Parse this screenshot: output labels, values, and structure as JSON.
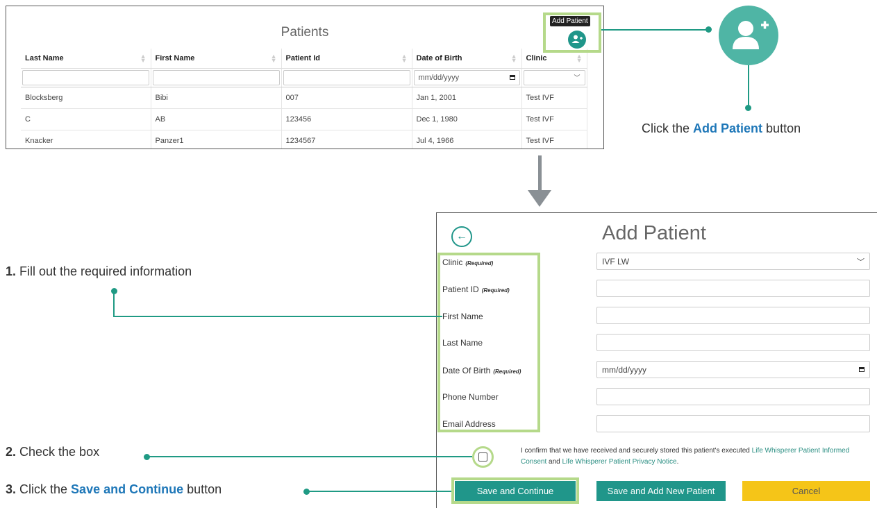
{
  "patients_panel": {
    "title": "Patients",
    "columns": [
      "Last Name",
      "First Name",
      "Patient Id",
      "Date of Birth",
      "Clinic"
    ],
    "date_filter_placeholder": "mm/dd/yyyy",
    "rows": [
      [
        "Blocksberg",
        "Bibi",
        "007",
        "Jan 1, 2001",
        "Test IVF"
      ],
      [
        "C",
        "AB",
        "123456",
        "Dec 1, 1980",
        "Test IVF"
      ],
      [
        "Knacker",
        "Panzer1",
        "1234567",
        "Jul 4, 1966",
        "Test IVF"
      ]
    ],
    "add_tooltip": "Add Patient"
  },
  "callouts": {
    "add_patient_pre": "Click the ",
    "add_patient_hl": "Add Patient",
    "add_patient_post": " button",
    "step1_num": "1.",
    "step1_text": " Fill out the required information",
    "step2_num": "2.",
    "step2_text": " Check the box",
    "step3_num": "3.",
    "step3_pre": " Click the ",
    "step3_hl": "Save and Continue",
    "step3_post": "  button"
  },
  "form": {
    "title": "Add Patient",
    "required_tag": "(Required)",
    "fields": [
      {
        "label": "Clinic",
        "required": true,
        "value": "IVF LW",
        "type": "select"
      },
      {
        "label": "Patient ID",
        "required": true,
        "value": "",
        "type": "text"
      },
      {
        "label": "First Name",
        "required": false,
        "value": "",
        "type": "text"
      },
      {
        "label": "Last Name",
        "required": false,
        "value": "",
        "type": "text"
      },
      {
        "label": "Date Of Birth",
        "required": true,
        "value": "mm/dd/yyyy",
        "type": "date"
      },
      {
        "label": "Phone Number",
        "required": false,
        "value": "",
        "type": "text"
      },
      {
        "label": "Email Address",
        "required": false,
        "value": "",
        "type": "text"
      }
    ],
    "consent_pre": "I confirm that we have received and securely stored this patient's executed ",
    "consent_link1": "Life Whisperer Patient Informed Consent",
    "consent_mid": " and ",
    "consent_link2": "Life Whisperer Patient Privacy Notice",
    "consent_end": ".",
    "buttons": {
      "save_continue": "Save and Continue",
      "save_add": "Save and Add New Patient",
      "cancel": "Cancel"
    }
  },
  "colors": {
    "teal": "#20968a",
    "highlight_green": "#b5d98a",
    "link_blue": "#1e77b8",
    "cancel_yellow": "#f5c518"
  }
}
